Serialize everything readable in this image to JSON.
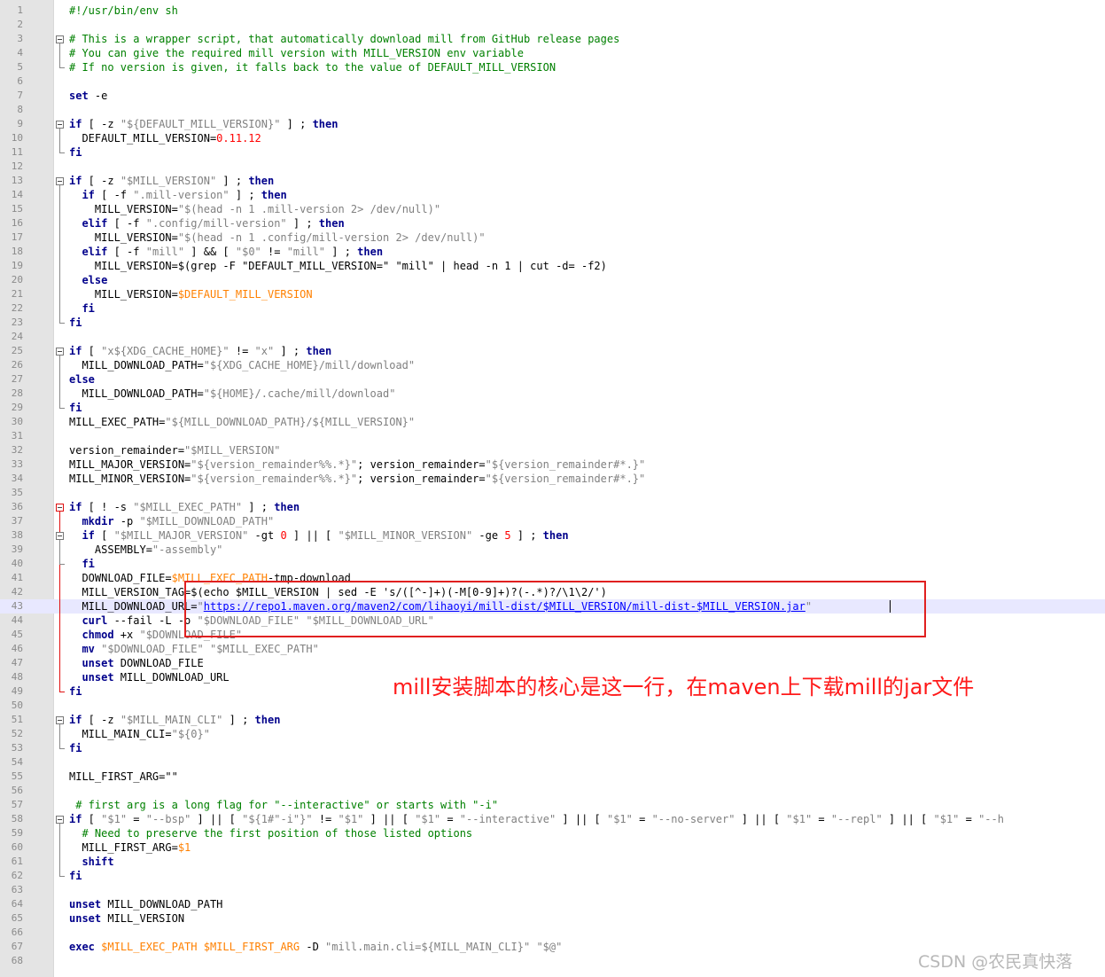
{
  "editor": {
    "lines": [
      {
        "n": "1",
        "tokens": [
          {
            "t": "#!/usr/bin/env sh",
            "c": "cm"
          }
        ]
      },
      {
        "n": "2",
        "tokens": []
      },
      {
        "n": "3",
        "tokens": [
          {
            "t": "# This is a wrapper script, that automatically download mill from GitHub release pages",
            "c": "cm"
          }
        ]
      },
      {
        "n": "4",
        "tokens": [
          {
            "t": "# You can give the required mill version with MILL_VERSION env variable",
            "c": "cm"
          }
        ]
      },
      {
        "n": "5",
        "tokens": [
          {
            "t": "# If no version is given, it falls back to the value of DEFAULT_MILL_VERSION",
            "c": "cm"
          }
        ]
      },
      {
        "n": "6",
        "tokens": []
      },
      {
        "n": "7",
        "tokens": [
          {
            "t": "set",
            "c": "kw"
          },
          {
            "t": " -e",
            "c": "op"
          }
        ]
      },
      {
        "n": "8",
        "tokens": []
      },
      {
        "n": "9",
        "tokens": [
          {
            "t": "if",
            "c": "kw"
          },
          {
            "t": " [ -z ",
            "c": "op"
          },
          {
            "t": "\"${DEFAULT_MILL_VERSION}\"",
            "c": "st"
          },
          {
            "t": " ] ; ",
            "c": "op"
          },
          {
            "t": "then",
            "c": "kw"
          }
        ]
      },
      {
        "n": "10",
        "tokens": [
          {
            "t": "  DEFAULT_MILL_VERSION=",
            "c": "op"
          },
          {
            "t": "0.11.12",
            "c": "nm"
          }
        ]
      },
      {
        "n": "11",
        "tokens": [
          {
            "t": "fi",
            "c": "kw"
          }
        ]
      },
      {
        "n": "12",
        "tokens": []
      },
      {
        "n": "13",
        "tokens": [
          {
            "t": "if",
            "c": "kw"
          },
          {
            "t": " [ -z ",
            "c": "op"
          },
          {
            "t": "\"$MILL_VERSION\"",
            "c": "st"
          },
          {
            "t": " ] ; ",
            "c": "op"
          },
          {
            "t": "then",
            "c": "kw"
          }
        ]
      },
      {
        "n": "14",
        "tokens": [
          {
            "t": "  ",
            "c": "op"
          },
          {
            "t": "if",
            "c": "kw"
          },
          {
            "t": " [ -f ",
            "c": "op"
          },
          {
            "t": "\".mill-version\"",
            "c": "st"
          },
          {
            "t": " ] ; ",
            "c": "op"
          },
          {
            "t": "then",
            "c": "kw"
          }
        ]
      },
      {
        "n": "15",
        "tokens": [
          {
            "t": "    MILL_VERSION=",
            "c": "op"
          },
          {
            "t": "\"$(head -n 1 .mill-version 2> /dev/null)\"",
            "c": "st"
          }
        ]
      },
      {
        "n": "16",
        "tokens": [
          {
            "t": "  ",
            "c": "op"
          },
          {
            "t": "elif",
            "c": "kw"
          },
          {
            "t": " [ -f ",
            "c": "op"
          },
          {
            "t": "\".config/mill-version\"",
            "c": "st"
          },
          {
            "t": " ] ; ",
            "c": "op"
          },
          {
            "t": "then",
            "c": "kw"
          }
        ]
      },
      {
        "n": "17",
        "tokens": [
          {
            "t": "    MILL_VERSION=",
            "c": "op"
          },
          {
            "t": "\"$(head -n 1 .config/mill-version 2> /dev/null)\"",
            "c": "st"
          }
        ]
      },
      {
        "n": "18",
        "tokens": [
          {
            "t": "  ",
            "c": "op"
          },
          {
            "t": "elif",
            "c": "kw"
          },
          {
            "t": " [ -f ",
            "c": "op"
          },
          {
            "t": "\"mill\"",
            "c": "st"
          },
          {
            "t": " ] && [ ",
            "c": "op"
          },
          {
            "t": "\"$0\"",
            "c": "st"
          },
          {
            "t": " != ",
            "c": "op"
          },
          {
            "t": "\"mill\"",
            "c": "st"
          },
          {
            "t": " ] ; ",
            "c": "op"
          },
          {
            "t": "then",
            "c": "kw"
          }
        ]
      },
      {
        "n": "19",
        "tokens": [
          {
            "t": "    MILL_VERSION=$(grep -F \"DEFAULT_MILL_VERSION=\" \"mill\" | head -n 1 | cut -d= -f2)",
            "c": "op"
          }
        ]
      },
      {
        "n": "20",
        "tokens": [
          {
            "t": "  ",
            "c": "op"
          },
          {
            "t": "else",
            "c": "kw"
          }
        ]
      },
      {
        "n": "21",
        "tokens": [
          {
            "t": "    MILL_VERSION=",
            "c": "op"
          },
          {
            "t": "$DEFAULT_MILL_VERSION",
            "c": "vr"
          }
        ]
      },
      {
        "n": "22",
        "tokens": [
          {
            "t": "  ",
            "c": "op"
          },
          {
            "t": "fi",
            "c": "kw"
          }
        ]
      },
      {
        "n": "23",
        "tokens": [
          {
            "t": "fi",
            "c": "kw"
          }
        ]
      },
      {
        "n": "24",
        "tokens": []
      },
      {
        "n": "25",
        "tokens": [
          {
            "t": "if",
            "c": "kw"
          },
          {
            "t": " [ ",
            "c": "op"
          },
          {
            "t": "\"x${XDG_CACHE_HOME}\"",
            "c": "st"
          },
          {
            "t": " != ",
            "c": "op"
          },
          {
            "t": "\"x\"",
            "c": "st"
          },
          {
            "t": " ] ; ",
            "c": "op"
          },
          {
            "t": "then",
            "c": "kw"
          }
        ]
      },
      {
        "n": "26",
        "tokens": [
          {
            "t": "  MILL_DOWNLOAD_PATH=",
            "c": "op"
          },
          {
            "t": "\"${XDG_CACHE_HOME}/mill/download\"",
            "c": "st"
          }
        ]
      },
      {
        "n": "27",
        "tokens": [
          {
            "t": "else",
            "c": "kw"
          }
        ]
      },
      {
        "n": "28",
        "tokens": [
          {
            "t": "  MILL_DOWNLOAD_PATH=",
            "c": "op"
          },
          {
            "t": "\"${HOME}/.cache/mill/download\"",
            "c": "st"
          }
        ]
      },
      {
        "n": "29",
        "tokens": [
          {
            "t": "fi",
            "c": "kw"
          }
        ]
      },
      {
        "n": "30",
        "tokens": [
          {
            "t": "MILL_EXEC_PATH=",
            "c": "op"
          },
          {
            "t": "\"${MILL_DOWNLOAD_PATH}/${MILL_VERSION}\"",
            "c": "st"
          }
        ]
      },
      {
        "n": "31",
        "tokens": []
      },
      {
        "n": "32",
        "tokens": [
          {
            "t": "version_remainder=",
            "c": "op"
          },
          {
            "t": "\"$MILL_VERSION\"",
            "c": "st"
          }
        ]
      },
      {
        "n": "33",
        "tokens": [
          {
            "t": "MILL_MAJOR_VERSION=",
            "c": "op"
          },
          {
            "t": "\"${version_remainder%%.*}\"",
            "c": "st"
          },
          {
            "t": "; version_remainder=",
            "c": "op"
          },
          {
            "t": "\"${version_remainder#*.}\"",
            "c": "st"
          }
        ]
      },
      {
        "n": "34",
        "tokens": [
          {
            "t": "MILL_MINOR_VERSION=",
            "c": "op"
          },
          {
            "t": "\"${version_remainder%%.*}\"",
            "c": "st"
          },
          {
            "t": "; version_remainder=",
            "c": "op"
          },
          {
            "t": "\"${version_remainder#*.}\"",
            "c": "st"
          }
        ]
      },
      {
        "n": "35",
        "tokens": []
      },
      {
        "n": "36",
        "tokens": [
          {
            "t": "if",
            "c": "kw"
          },
          {
            "t": " [ ! -s ",
            "c": "op"
          },
          {
            "t": "\"$MILL_EXEC_PATH\"",
            "c": "st"
          },
          {
            "t": " ] ; ",
            "c": "op"
          },
          {
            "t": "then",
            "c": "kw"
          }
        ]
      },
      {
        "n": "37",
        "tokens": [
          {
            "t": "  ",
            "c": "op"
          },
          {
            "t": "mkdir",
            "c": "kw"
          },
          {
            "t": " -p ",
            "c": "op"
          },
          {
            "t": "\"$MILL_DOWNLOAD_PATH\"",
            "c": "st"
          }
        ]
      },
      {
        "n": "38",
        "tokens": [
          {
            "t": "  ",
            "c": "op"
          },
          {
            "t": "if",
            "c": "kw"
          },
          {
            "t": " [ ",
            "c": "op"
          },
          {
            "t": "\"$MILL_MAJOR_VERSION\"",
            "c": "st"
          },
          {
            "t": " -gt ",
            "c": "op"
          },
          {
            "t": "0",
            "c": "nm"
          },
          {
            "t": " ] || [ ",
            "c": "op"
          },
          {
            "t": "\"$MILL_MINOR_VERSION\"",
            "c": "st"
          },
          {
            "t": " -ge ",
            "c": "op"
          },
          {
            "t": "5",
            "c": "nm"
          },
          {
            "t": " ] ; ",
            "c": "op"
          },
          {
            "t": "then",
            "c": "kw"
          }
        ]
      },
      {
        "n": "39",
        "tokens": [
          {
            "t": "    ASSEMBLY=",
            "c": "op"
          },
          {
            "t": "\"-assembly\"",
            "c": "st"
          }
        ]
      },
      {
        "n": "40",
        "tokens": [
          {
            "t": "  ",
            "c": "op"
          },
          {
            "t": "fi",
            "c": "kw"
          }
        ]
      },
      {
        "n": "41",
        "tokens": [
          {
            "t": "  DOWNLOAD_FILE=",
            "c": "op"
          },
          {
            "t": "$MILL_EXEC_PATH",
            "c": "vr"
          },
          {
            "t": "-tmp-download",
            "c": "op"
          }
        ]
      },
      {
        "n": "42",
        "tokens": [
          {
            "t": "  MILL_VERSION_TAG=$(echo $MILL_VERSION | sed -E 's/([^-]+)(-M[0-9]+)?(-.*)?/\\1\\2/')",
            "c": "op"
          }
        ]
      },
      {
        "n": "43",
        "tokens": [
          {
            "t": "  MILL_DOWNLOAD_URL=",
            "c": "op"
          },
          {
            "t": "\"",
            "c": "st"
          },
          {
            "t": "https://repo1.maven.org/maven2/com/lihaoyi/mill-dist/$MILL_VERSION/mill-dist-$MILL_VERSION.jar",
            "c": "url"
          },
          {
            "t": "\"",
            "c": "st"
          }
        ]
      },
      {
        "n": "44",
        "tokens": [
          {
            "t": "  ",
            "c": "op"
          },
          {
            "t": "curl",
            "c": "kw"
          },
          {
            "t": " --fail -L -o ",
            "c": "op"
          },
          {
            "t": "\"$DOWNLOAD_FILE\"",
            "c": "st"
          },
          {
            "t": " ",
            "c": "op"
          },
          {
            "t": "\"$MILL_DOWNLOAD_URL\"",
            "c": "st"
          }
        ]
      },
      {
        "n": "45",
        "tokens": [
          {
            "t": "  ",
            "c": "op"
          },
          {
            "t": "chmod",
            "c": "kw"
          },
          {
            "t": " +x ",
            "c": "op"
          },
          {
            "t": "\"$DOWNLOAD_FILE\"",
            "c": "st"
          }
        ]
      },
      {
        "n": "46",
        "tokens": [
          {
            "t": "  ",
            "c": "op"
          },
          {
            "t": "mv",
            "c": "kw"
          },
          {
            "t": " ",
            "c": "op"
          },
          {
            "t": "\"$DOWNLOAD_FILE\"",
            "c": "st"
          },
          {
            "t": " ",
            "c": "op"
          },
          {
            "t": "\"$MILL_EXEC_PATH\"",
            "c": "st"
          }
        ]
      },
      {
        "n": "47",
        "tokens": [
          {
            "t": "  ",
            "c": "op"
          },
          {
            "t": "unset",
            "c": "kw"
          },
          {
            "t": " DOWNLOAD_FILE",
            "c": "op"
          }
        ]
      },
      {
        "n": "48",
        "tokens": [
          {
            "t": "  ",
            "c": "op"
          },
          {
            "t": "unset",
            "c": "kw"
          },
          {
            "t": " MILL_DOWNLOAD_URL",
            "c": "op"
          }
        ]
      },
      {
        "n": "49",
        "tokens": [
          {
            "t": "fi",
            "c": "kw"
          }
        ]
      },
      {
        "n": "50",
        "tokens": []
      },
      {
        "n": "51",
        "tokens": [
          {
            "t": "if",
            "c": "kw"
          },
          {
            "t": " [ -z ",
            "c": "op"
          },
          {
            "t": "\"$MILL_MAIN_CLI\"",
            "c": "st"
          },
          {
            "t": " ] ; ",
            "c": "op"
          },
          {
            "t": "then",
            "c": "kw"
          }
        ]
      },
      {
        "n": "52",
        "tokens": [
          {
            "t": "  MILL_MAIN_CLI=",
            "c": "op"
          },
          {
            "t": "\"${0}\"",
            "c": "st"
          }
        ]
      },
      {
        "n": "53",
        "tokens": [
          {
            "t": "fi",
            "c": "kw"
          }
        ]
      },
      {
        "n": "54",
        "tokens": []
      },
      {
        "n": "55",
        "tokens": [
          {
            "t": "MILL_FIRST_ARG=\"\"",
            "c": "op"
          }
        ]
      },
      {
        "n": "56",
        "tokens": []
      },
      {
        "n": "57",
        "tokens": [
          {
            "t": " # first arg is a long flag for \"--interactive\" or starts with \"-i\"",
            "c": "cm"
          }
        ]
      },
      {
        "n": "58",
        "tokens": [
          {
            "t": "if",
            "c": "kw"
          },
          {
            "t": " [ ",
            "c": "op"
          },
          {
            "t": "\"$1\"",
            "c": "st"
          },
          {
            "t": " = ",
            "c": "op"
          },
          {
            "t": "\"--bsp\"",
            "c": "st"
          },
          {
            "t": " ] || [ ",
            "c": "op"
          },
          {
            "t": "\"${1#\"-i\"}\"",
            "c": "st"
          },
          {
            "t": " != ",
            "c": "op"
          },
          {
            "t": "\"$1\"",
            "c": "st"
          },
          {
            "t": " ] || [ ",
            "c": "op"
          },
          {
            "t": "\"$1\"",
            "c": "st"
          },
          {
            "t": " = ",
            "c": "op"
          },
          {
            "t": "\"--interactive\"",
            "c": "st"
          },
          {
            "t": " ] || [ ",
            "c": "op"
          },
          {
            "t": "\"$1\"",
            "c": "st"
          },
          {
            "t": " = ",
            "c": "op"
          },
          {
            "t": "\"--no-server\"",
            "c": "st"
          },
          {
            "t": " ] || [ ",
            "c": "op"
          },
          {
            "t": "\"$1\"",
            "c": "st"
          },
          {
            "t": " = ",
            "c": "op"
          },
          {
            "t": "\"--repl\"",
            "c": "st"
          },
          {
            "t": " ] || [ ",
            "c": "op"
          },
          {
            "t": "\"$1\"",
            "c": "st"
          },
          {
            "t": " = ",
            "c": "op"
          },
          {
            "t": "\"--h",
            "c": "st"
          }
        ]
      },
      {
        "n": "59",
        "tokens": [
          {
            "t": "  # Need to preserve the first position of those listed options",
            "c": "cm"
          }
        ]
      },
      {
        "n": "60",
        "tokens": [
          {
            "t": "  MILL_FIRST_ARG=",
            "c": "op"
          },
          {
            "t": "$1",
            "c": "vr"
          }
        ]
      },
      {
        "n": "61",
        "tokens": [
          {
            "t": "  ",
            "c": "op"
          },
          {
            "t": "shift",
            "c": "kw"
          }
        ]
      },
      {
        "n": "62",
        "tokens": [
          {
            "t": "fi",
            "c": "kw"
          }
        ]
      },
      {
        "n": "63",
        "tokens": []
      },
      {
        "n": "64",
        "tokens": [
          {
            "t": "unset",
            "c": "kw"
          },
          {
            "t": " MILL_DOWNLOAD_PATH",
            "c": "op"
          }
        ]
      },
      {
        "n": "65",
        "tokens": [
          {
            "t": "unset",
            "c": "kw"
          },
          {
            "t": " MILL_VERSION",
            "c": "op"
          }
        ]
      },
      {
        "n": "66",
        "tokens": []
      },
      {
        "n": "67",
        "tokens": [
          {
            "t": "exec",
            "c": "kw"
          },
          {
            "t": " ",
            "c": "op"
          },
          {
            "t": "$MILL_EXEC_PATH",
            "c": "vr"
          },
          {
            "t": " ",
            "c": "op"
          },
          {
            "t": "$MILL_FIRST_ARG",
            "c": "vr"
          },
          {
            "t": " -D ",
            "c": "op"
          },
          {
            "t": "\"mill.main.cli=${MILL_MAIN_CLI}\"",
            "c": "st"
          },
          {
            "t": " ",
            "c": "op"
          },
          {
            "t": "\"$@\"",
            "c": "st"
          }
        ]
      },
      {
        "n": "68",
        "tokens": []
      }
    ],
    "highlighted_line": "43"
  },
  "annotation": {
    "text": "mill安装脚本的核心是这一行，在maven上下载mill的jar文件",
    "color": "#ff1a1a"
  },
  "watermark": {
    "text": "CSDN @农民真快落"
  },
  "colors": {
    "keyword": "#00008b",
    "comment": "#008000",
    "string": "#808080",
    "number": "#ff0000",
    "variable": "#ff8000",
    "url": "#0000ff",
    "annotation_box": "#e02020"
  }
}
